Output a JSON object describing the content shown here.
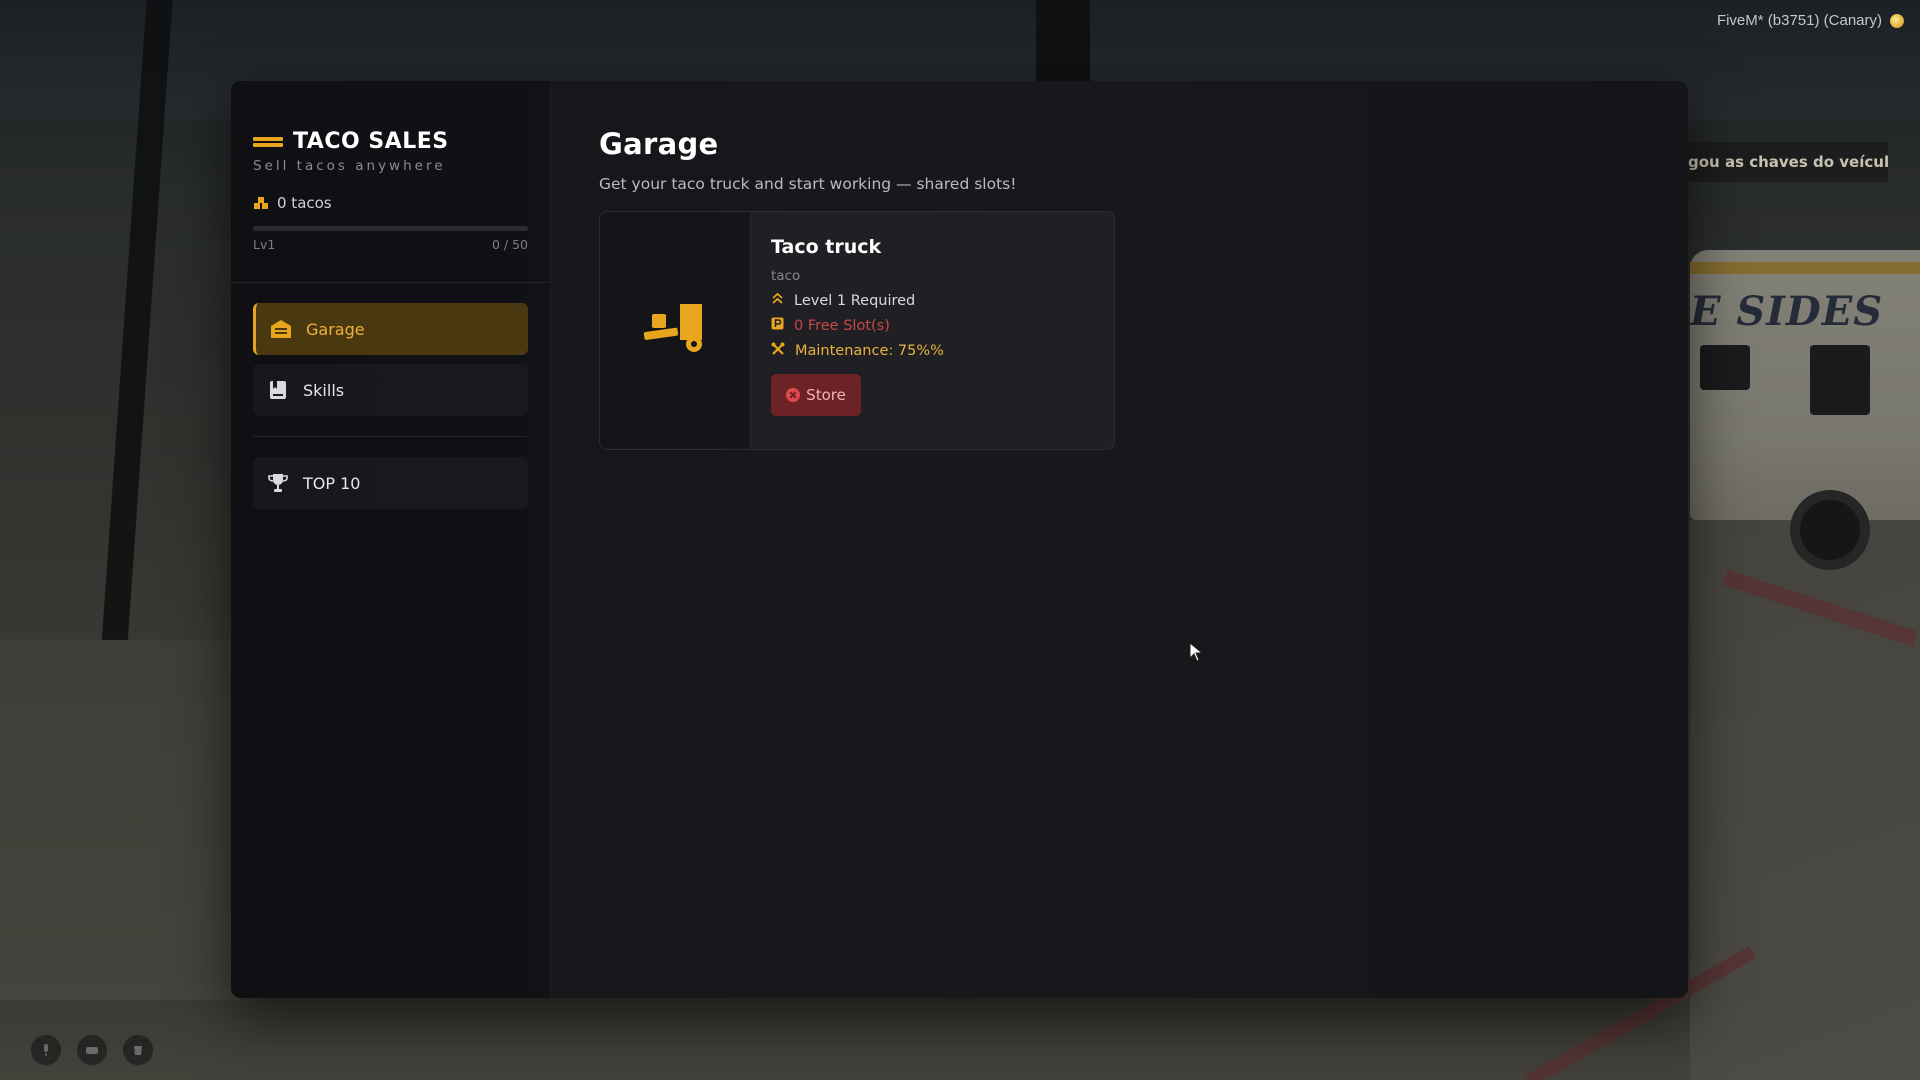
{
  "overlay": {
    "fivem_label": "FiveM* (b3751) (Canary)",
    "notification": "gou as chaves do veículo!",
    "truck_livery": "E SIDES"
  },
  "sidebar": {
    "brand_title": "TACO SALES",
    "brand_subtitle": "Sell tacos anywhere",
    "tacos_count": "0 tacos",
    "level_label": "Lv1",
    "xp_label": "0 / 50",
    "xp_progress": 0,
    "nav": [
      {
        "label": "Garage",
        "icon": "garage-icon",
        "active": true
      },
      {
        "label": "Skills",
        "icon": "book-icon",
        "active": false
      },
      {
        "label": "TOP 10",
        "icon": "trophy-icon",
        "active": false
      }
    ]
  },
  "main": {
    "title": "Garage",
    "subtitle": "Get your taco truck and start working — shared slots!",
    "vehicle": {
      "name": "Taco truck",
      "tag": "taco",
      "level_required": "Level 1 Required",
      "free_slots": "0 Free Slot(s)",
      "maintenance": "Maintenance: 75%%",
      "store_label": "Store",
      "icon": "hand-truck-icon"
    }
  },
  "colors": {
    "accent": "#e8a41c",
    "danger": "#c94646",
    "panel_bg": "#151519",
    "sidebar_bg": "#101014"
  }
}
